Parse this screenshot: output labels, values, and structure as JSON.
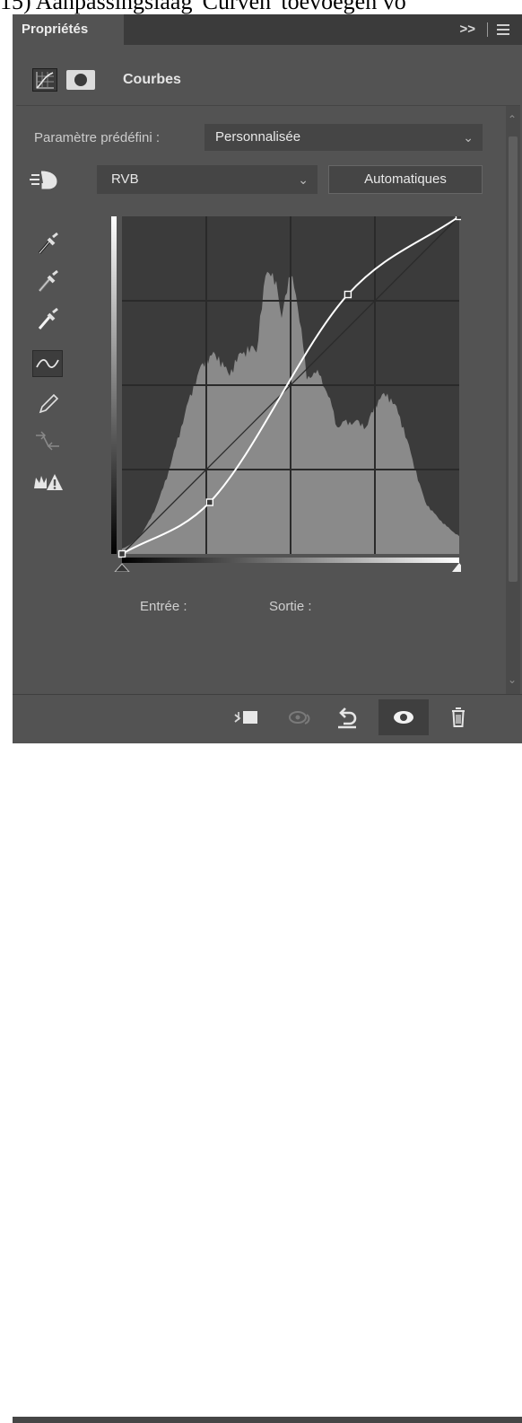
{
  "caption": "15) Aanpassingslaag 'Curven' toevoegen vo",
  "panel": {
    "tab_label": "Propriétés",
    "collapse_glyph": ">>",
    "menu_icon": "panel-menu-icon"
  },
  "header": {
    "icon_curves": "curves-adjustment-icon",
    "icon_mask": "layer-mask-icon",
    "title": "Courbes"
  },
  "preset": {
    "label": "Paramètre prédéfini :",
    "value": "Personnalisée"
  },
  "channel": {
    "value": "RVB"
  },
  "auto_button": "Automatiques",
  "tools": [
    "sample-black-eyedropper-icon",
    "sample-gray-eyedropper-icon",
    "sample-white-eyedropper-icon",
    "curve-points-icon",
    "pencil-icon",
    "smooth-curve-icon",
    "clipping-warning-icon"
  ],
  "curve": {
    "points": [
      [
        0,
        0
      ],
      [
        26,
        39
      ],
      [
        67,
        196
      ],
      [
        100,
        255
      ]
    ],
    "input_label": "Entrée :",
    "output_label": "Sortie :"
  },
  "colors": {
    "panel_bg": "#535353",
    "graph_bg": "#3b3b3b",
    "histogram": "#8a8a8a",
    "curve": "#ffffff"
  },
  "footer": [
    "clip-to-layer-icon",
    "view-previous-state-icon",
    "reset-icon",
    "visibility-eye-icon",
    "delete-icon"
  ]
}
